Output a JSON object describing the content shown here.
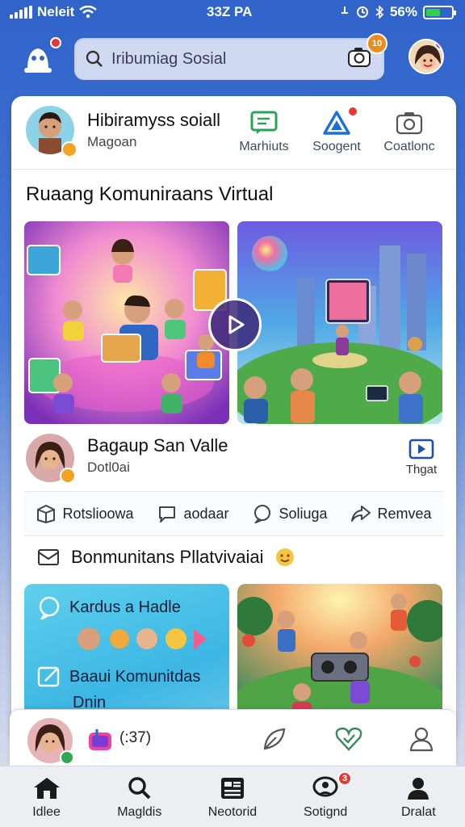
{
  "status_bar": {
    "carrier": "Neleit",
    "time": "33Z PA",
    "battery": "56%",
    "battery_level": 0.56
  },
  "header": {
    "search_text": "Iribumiag Sosial",
    "camera_badge": "10",
    "notif_badge": ""
  },
  "profile": {
    "name": "Hibiramyss soiall",
    "subtitle": "Magoan",
    "actions": [
      {
        "label": "Marhiuts",
        "icon": "chat-icon"
      },
      {
        "label": "Soogent",
        "icon": "triangle-icon",
        "badge": ""
      },
      {
        "label": "Coatlonc",
        "icon": "camera-icon"
      }
    ]
  },
  "section_title": "Ruaang Komuniraans Virtual",
  "post": {
    "name": "Bagaup San Valle",
    "subtitle": "Dotl0ai",
    "action_label": "Thgat"
  },
  "reactions": [
    {
      "label": "Rotslioowa",
      "icon": "box-icon"
    },
    {
      "label": "aodaar",
      "icon": "comment-icon"
    },
    {
      "label": "Soliuga",
      "icon": "share-bubble-icon"
    },
    {
      "label": "Remvea",
      "icon": "forward-icon"
    }
  ],
  "section2_title": "Bonmunitans Pllatvivaiai",
  "tile_left": {
    "line1": "Kardus a Hadle",
    "line2": "Baaui Komunitdas",
    "line3": "Dnin"
  },
  "composer": {
    "count": "(:37)"
  },
  "nav": [
    {
      "label": "Idlee",
      "icon": "home-icon"
    },
    {
      "label": "Magldis",
      "icon": "search-icon"
    },
    {
      "label": "Neotorid",
      "icon": "news-icon"
    },
    {
      "label": "Sotignd",
      "icon": "chat-people-icon",
      "badge": "3"
    },
    {
      "label": "Dralat",
      "icon": "person-icon"
    }
  ],
  "colors": {
    "accent": "#2f63c9",
    "badge": "#e53935",
    "play": "#3c2878"
  }
}
